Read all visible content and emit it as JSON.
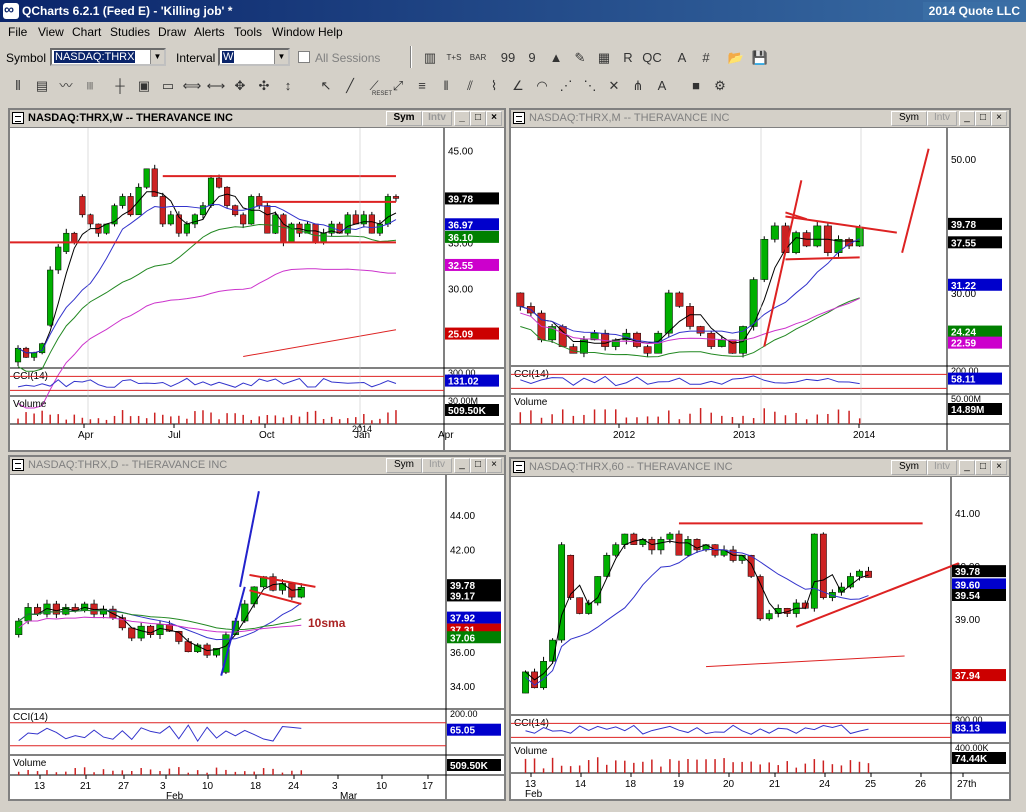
{
  "window": {
    "title": "QCharts 6.2.1 (Feed E) - 'Killing job' *",
    "company": "2014 Quote LLC"
  },
  "menu": [
    "File",
    "View",
    "Chart",
    "Studies",
    "Draw",
    "Alerts",
    "Tools",
    "Window",
    "Help"
  ],
  "toolbar": {
    "symbol_label": "Symbol",
    "symbol_value": "NASDAQ:THRX",
    "interval_label": "Interval",
    "interval_value": "W",
    "all_sessions_label": "All Sessions",
    "tools_row1": [
      "bar-chart-icon",
      "time-sales-icon",
      "bar-icon",
      "quote-99-icon",
      "quote-9-icon",
      "alert-icon",
      "pencil-icon",
      "level2-icon",
      "news-icon",
      "qc-icon",
      "text-icon",
      "grid-icon",
      "open-icon",
      "save-icon"
    ],
    "tools_row2": [
      "candle-icon",
      "chart-style-icon",
      "line-icon",
      "histogram-icon",
      "crosshair-icon",
      "data-window-icon",
      "dash-icon",
      "zoom-out-icon",
      "zoom-in-icon",
      "scroll-icon",
      "pan-icon",
      "reset-icon",
      "pointer-icon",
      "trendline-icon",
      "ray-icon",
      "extend-icon",
      "fib-icon",
      "bars-icon",
      "channel-icon",
      "cycles-icon",
      "gann-icon",
      "arc-icon",
      "fan-icon",
      "speed-icon",
      "cross-icon",
      "pitchfork-icon",
      "annotate-icon",
      "color-icon",
      "properties-icon"
    ],
    "reset_label": "RESET"
  },
  "panel_buttons": {
    "sym": "Sym",
    "intv": "Intv"
  },
  "panels": [
    {
      "id": "weekly",
      "title": "NASDAQ:THRX,W -- THERAVANCE INC",
      "active": true,
      "price_labels": [
        "45.00",
        "40.00",
        "35.00",
        "30.00",
        "25.00"
      ],
      "badges": [
        {
          "text": "39.78",
          "color": "#000000"
        },
        {
          "text": "36.97",
          "color": "#0000cc"
        },
        {
          "text": "36.10",
          "color": "#008000"
        },
        {
          "text": "32.55",
          "color": "#cc00cc"
        },
        {
          "text": "25.09",
          "color": "#cc0000"
        }
      ],
      "cci_label": "CCI(14)",
      "cci_scale": "300.00",
      "cci_value": "131.02",
      "volume_label": "Volume",
      "volume_scale": "30.00M",
      "volume_value": "509.50K",
      "x_labels": [
        "Apr",
        "Jul",
        "Oct",
        "Jan",
        "Apr"
      ],
      "x_year": "2014"
    },
    {
      "id": "monthly",
      "title": "NASDAQ:THRX,M -- THERAVANCE INC",
      "active": false,
      "price_labels": [
        "50.00",
        "30.00"
      ],
      "badges": [
        {
          "text": "39.78",
          "color": "#000000"
        },
        {
          "text": "37.55",
          "color": "#000000"
        },
        {
          "text": "31.22",
          "color": "#0000cc"
        },
        {
          "text": "24.24",
          "color": "#008000"
        },
        {
          "text": "22.59",
          "color": "#cc00cc"
        }
      ],
      "cci_label": "CCI(14)",
      "cci_scale": "200.00",
      "cci_value": "58.11",
      "volume_label": "Volume",
      "volume_scale": "50.00M",
      "volume_value": "14.89M",
      "x_labels": [
        "2012",
        "2013",
        "2014"
      ]
    },
    {
      "id": "daily",
      "title": "NASDAQ:THRX,D -- THERAVANCE INC",
      "active": false,
      "price_labels": [
        "44.00",
        "42.00",
        "36.00",
        "34.00"
      ],
      "badges": [
        {
          "text": "39.78",
          "color": "#000000"
        },
        {
          "text": "39.17",
          "color": "#000000"
        },
        {
          "text": "37.92",
          "color": "#0000cc"
        },
        {
          "text": "37.31",
          "color": "#cc0000"
        },
        {
          "text": "37.06",
          "color": "#008000"
        }
      ],
      "annotation": "10sma",
      "cci_label": "CCI(14)",
      "cci_scale": "200.00",
      "cci_value": "65.05",
      "volume_label": "Volume",
      "volume_value": "509.50K",
      "x_labels": [
        "13",
        "21",
        "27",
        "3",
        "10",
        "18",
        "24",
        "3",
        "10",
        "17"
      ],
      "x_months": [
        "Feb",
        "Mar"
      ]
    },
    {
      "id": "hourly",
      "title": "NASDAQ:THRX,60 -- THERAVANCE INC",
      "active": false,
      "price_labels": [
        "41.00",
        "40.00",
        "39.00"
      ],
      "badges": [
        {
          "text": "39.78",
          "color": "#000000"
        },
        {
          "text": "39.60",
          "color": "#0000cc"
        },
        {
          "text": "39.54",
          "color": "#000000"
        },
        {
          "text": "37.94",
          "color": "#cc0000"
        }
      ],
      "cci_label": "CCI(14)",
      "cci_scale": "300.00",
      "cci_value": "83.13",
      "volume_label": "Volume",
      "volume_scale": "400.00K",
      "volume_value": "74.44K",
      "x_labels": [
        "13",
        "14",
        "18",
        "19",
        "20",
        "21",
        "24",
        "25",
        "26",
        "27th"
      ],
      "x_months": [
        "Feb"
      ]
    }
  ],
  "colors": {
    "up_candle": "#00b000",
    "down_candle": "#cc2222",
    "trend_red": "#dd2222",
    "trend_blue": "#2222cc",
    "ma_black": "#000000",
    "ma_blue": "#3333cc",
    "ma_green": "#228822",
    "ma_magenta": "#cc33cc",
    "ma_red": "#cc2222"
  }
}
